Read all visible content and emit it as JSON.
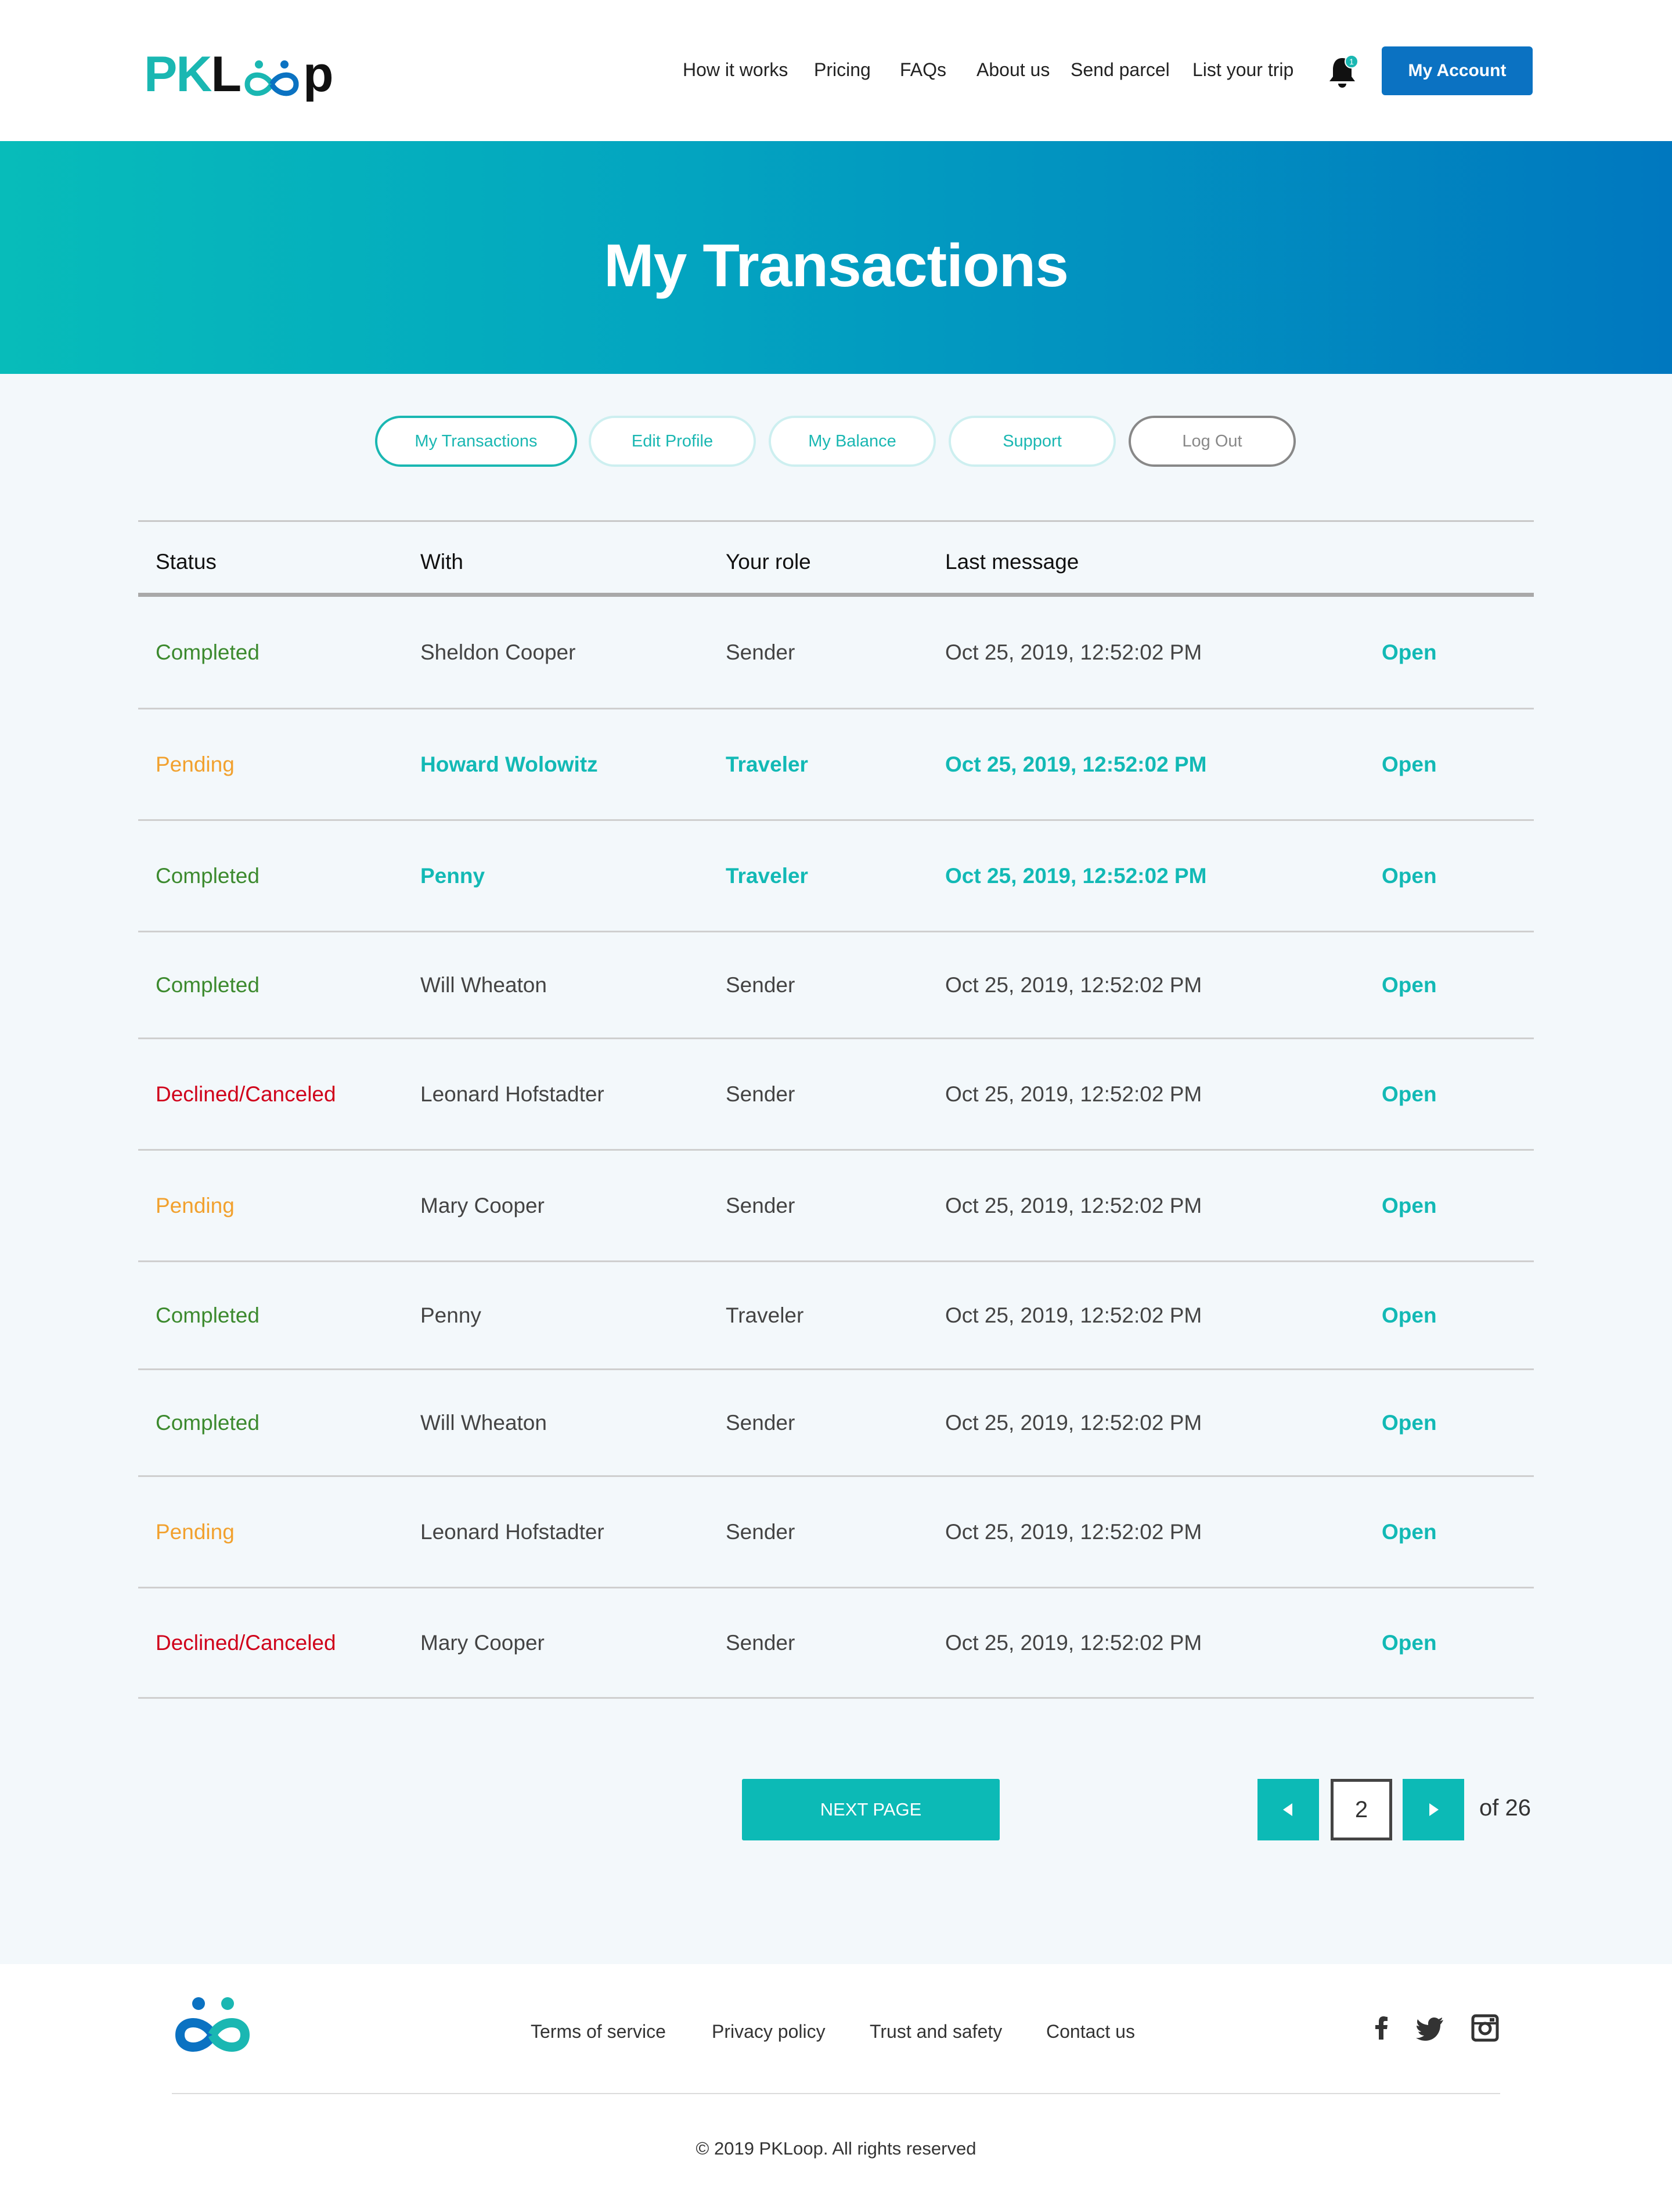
{
  "brand": {
    "logo_prefix": "PK",
    "logo_l": "L",
    "logo_suffix": "p",
    "teal": "#1ab7b2",
    "blue": "#0b72c2"
  },
  "nav": {
    "items": [
      "How it works",
      "Pricing",
      "FAQs",
      "About us",
      "Send parcel",
      "List your trip"
    ],
    "notification_count": "1",
    "account_label": "My Account"
  },
  "hero": {
    "title": "My Transactions"
  },
  "tabs": [
    {
      "label": "My Transactions",
      "active": true
    },
    {
      "label": "Edit Profile",
      "active": false
    },
    {
      "label": "My Balance",
      "active": false
    },
    {
      "label": "Support",
      "active": false
    },
    {
      "label": "Log Out",
      "active": false
    }
  ],
  "table": {
    "headers": [
      "Status",
      "With",
      "Your role",
      "Last message"
    ],
    "rows": [
      {
        "status": "Completed",
        "status_type": "completed",
        "with": "Sheldon Cooper",
        "role": "Sender",
        "last_message": "Oct 25, 2019, 12:52:02 PM",
        "action": "Open",
        "unread": false
      },
      {
        "status": "Pending",
        "status_type": "pending",
        "with": "Howard Wolowitz",
        "role": "Traveler",
        "last_message": "Oct 25, 2019, 12:52:02 PM",
        "action": "Open",
        "unread": true
      },
      {
        "status": "Completed",
        "status_type": "completed",
        "with": "Penny",
        "role": "Traveler",
        "last_message": "Oct 25, 2019, 12:52:02 PM",
        "action": "Open",
        "unread": true
      },
      {
        "status": "Completed",
        "status_type": "completed",
        "with": "Will Wheaton",
        "role": "Sender",
        "last_message": "Oct 25, 2019, 12:52:02 PM",
        "action": "Open",
        "unread": false
      },
      {
        "status": "Declined/Canceled",
        "status_type": "declined",
        "with": "Leonard Hofstadter",
        "role": "Sender",
        "last_message": "Oct 25, 2019, 12:52:02 PM",
        "action": "Open",
        "unread": false
      },
      {
        "status": "Pending",
        "status_type": "pending",
        "with": "Mary Cooper",
        "role": "Sender",
        "last_message": "Oct 25, 2019, 12:52:02 PM",
        "action": "Open",
        "unread": false
      },
      {
        "status": "Completed",
        "status_type": "completed",
        "with": "Penny",
        "role": "Traveler",
        "last_message": "Oct 25, 2019, 12:52:02 PM",
        "action": "Open",
        "unread": false
      },
      {
        "status": "Completed",
        "status_type": "completed",
        "with": "Will Wheaton",
        "role": "Sender",
        "last_message": "Oct 25, 2019, 12:52:02 PM",
        "action": "Open",
        "unread": false
      },
      {
        "status": "Pending",
        "status_type": "pending",
        "with": "Leonard Hofstadter",
        "role": "Sender",
        "last_message": "Oct 25, 2019, 12:52:02 PM",
        "action": "Open",
        "unread": false
      },
      {
        "status": "Declined/Canceled",
        "status_type": "declined",
        "with": "Mary Cooper",
        "role": "Sender",
        "last_message": "Oct 25, 2019, 12:52:02 PM",
        "action": "Open",
        "unread": false
      }
    ]
  },
  "pagination": {
    "next_label": "NEXT PAGE",
    "current_page": "2",
    "of_label": "of 26"
  },
  "footer": {
    "links": [
      "Terms of service",
      "Privacy policy",
      "Trust and safety",
      "Contact us"
    ],
    "social": [
      "facebook-icon",
      "twitter-icon",
      "instagram-icon"
    ],
    "copyright": "© 2019 PKLoop. All rights reserved"
  }
}
